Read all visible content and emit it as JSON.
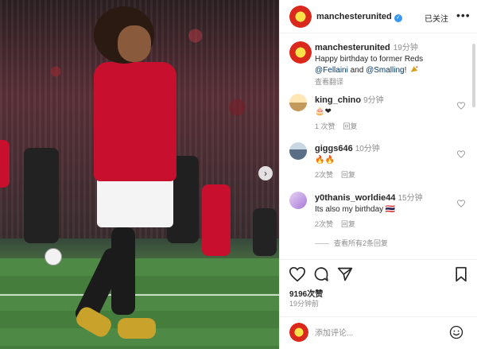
{
  "post": {
    "username": "manchesterunited",
    "follow_state": "已关注",
    "caption": {
      "time": "19分钟",
      "text_line1": "Happy birthday to former Reds",
      "mention1": "@Fellaini",
      "and": "and",
      "mention2": "@Smalling",
      "punct": "!",
      "translate": "查看翻译"
    }
  },
  "comments": [
    {
      "username": "king_chino",
      "time": "9分钟",
      "text": "🎂❤",
      "likes": "1 次赞",
      "reply": "回复"
    },
    {
      "username": "giggs646",
      "time": "10分钟",
      "text": "🔥🔥",
      "likes": "2次赞",
      "reply": "回复"
    },
    {
      "username": "y0thanis_worldie44",
      "time": "15分钟",
      "text": "Its also my birthday 🇹🇭",
      "likes": "2次赞",
      "reply": "回复"
    }
  ],
  "view_replies": "查看所有2条回复",
  "actions": {
    "likes": "9196次赞",
    "posted": "19分钟前"
  },
  "composer": {
    "placeholder": "添加评论..."
  },
  "icons": {
    "like": "heart-icon",
    "comment": "comment-icon",
    "share": "paper-plane-icon",
    "save": "bookmark-icon",
    "more": "more-icon",
    "emoji": "emoji-icon",
    "next": "chevron-right-icon"
  },
  "colors": {
    "mention": "#00376b",
    "muted": "#8e8e8e",
    "verified": "#3897f0",
    "brand_red": "#da291c"
  }
}
